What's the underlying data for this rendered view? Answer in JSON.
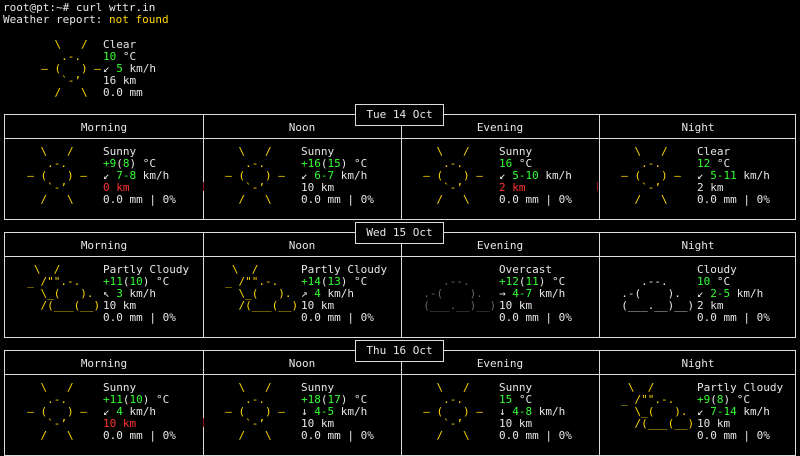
{
  "terminal": {
    "prompt": "root@pt:~# curl wttr.in",
    "report_label": "Weather report:",
    "report_value": "not found"
  },
  "current": {
    "desc": "Clear",
    "temp": "10",
    "temp_unit": "°C",
    "wind_arrow": "↙",
    "wind_val": "5",
    "wind_unit": "km/h",
    "vis": "16 km",
    "precip": "0.0 mm"
  },
  "days": [
    {
      "date": "Tue 14 Oct",
      "periods": [
        "Morning",
        "Noon",
        "Evening",
        "Night"
      ],
      "cells": [
        {
          "icon": "sunny",
          "desc": "Sunny",
          "t1": "+9",
          "t2": "8",
          "unit": "°C",
          "arrow": "↙",
          "wind": "7-8",
          "wunit": "km/h",
          "vis": "0 km",
          "visRed": true,
          "precip": "0.0 mm | 0%"
        },
        {
          "icon": "sunny",
          "desc": "Sunny",
          "t1": "+16",
          "t2": "15",
          "unit": "°C",
          "arrow": "↙",
          "wind": "6-7",
          "wunit": "km/h",
          "vis": "10 km",
          "visRed": false,
          "precip": "0.0 mm | 0%"
        },
        {
          "icon": "sunny",
          "desc": "Sunny",
          "t1": "16",
          "t2": "",
          "unit": "°C",
          "arrow": "↙",
          "wind": "5-10",
          "wunit": "km/h",
          "vis": "2 km",
          "visRed": true,
          "precip": "0.0 mm | 0%"
        },
        {
          "icon": "sunny",
          "desc": "Clear",
          "t1": "12",
          "t2": "",
          "unit": "°C",
          "arrow": "↙",
          "wind": "5-11",
          "wunit": "km/h",
          "vis": "2 km",
          "visRed": false,
          "precip": "0.0 mm | 0%"
        }
      ]
    },
    {
      "date": "Wed 15 Oct",
      "periods": [
        "Morning",
        "Noon",
        "Evening",
        "Night"
      ],
      "cells": [
        {
          "icon": "partly",
          "desc": "Partly Cloudy",
          "t1": "+11",
          "t2": "10",
          "unit": "°C",
          "arrow": "↖",
          "wind": "3",
          "wunit": "km/h",
          "vis": "10 km",
          "visRed": false,
          "precip": "0.0 mm | 0%"
        },
        {
          "icon": "partly",
          "desc": "Partly Cloudy",
          "t1": "+14",
          "t2": "13",
          "unit": "°C",
          "arrow": "↗",
          "wind": "4",
          "wunit": "km/h",
          "vis": "10 km",
          "visRed": false,
          "precip": "0.0 mm | 0%"
        },
        {
          "icon": "overcast",
          "desc": "Overcast",
          "t1": "+12",
          "t2": "11",
          "unit": "°C",
          "arrow": "→",
          "wind": "4-7",
          "wunit": "km/h",
          "vis": "10 km",
          "visRed": false,
          "precip": "0.0 mm | 0%"
        },
        {
          "icon": "cloudy",
          "desc": "Cloudy",
          "t1": "10",
          "t2": "",
          "unit": "°C",
          "arrow": "↙",
          "wind": "2-5",
          "wunit": "km/h",
          "vis": "2 km",
          "visRed": false,
          "precip": "0.0 mm | 0%"
        }
      ]
    },
    {
      "date": "Thu 16 Oct",
      "periods": [
        "Morning",
        "Noon",
        "Evening",
        "Night"
      ],
      "cells": [
        {
          "icon": "sunny",
          "desc": "Sunny",
          "t1": "+11",
          "t2": "10",
          "unit": "°C",
          "arrow": "↙",
          "wind": "4",
          "wunit": "km/h",
          "vis": "10 km",
          "visRed": true,
          "precip": "0.0 mm | 0%"
        },
        {
          "icon": "sunny",
          "desc": "Sunny",
          "t1": "+18",
          "t2": "17",
          "unit": "°C",
          "arrow": "↓",
          "wind": "4-5",
          "wunit": "km/h",
          "vis": "10 km",
          "visRed": false,
          "precip": "0.0 mm | 0%"
        },
        {
          "icon": "sunny",
          "desc": "Sunny",
          "t1": "15",
          "t2": "",
          "unit": "°C",
          "arrow": "↓",
          "wind": "4-8",
          "wunit": "km/h",
          "vis": "10 km",
          "visRed": false,
          "precip": "0.0 mm | 0%"
        },
        {
          "icon": "partly",
          "desc": "Partly Cloudy",
          "t1": "+9",
          "t2": "8",
          "unit": "°C",
          "arrow": "↙",
          "wind": "7-14",
          "wunit": "km/h",
          "vis": "10 km",
          "visRed": false,
          "precip": "0.0 mm | 0%"
        }
      ]
    }
  ]
}
